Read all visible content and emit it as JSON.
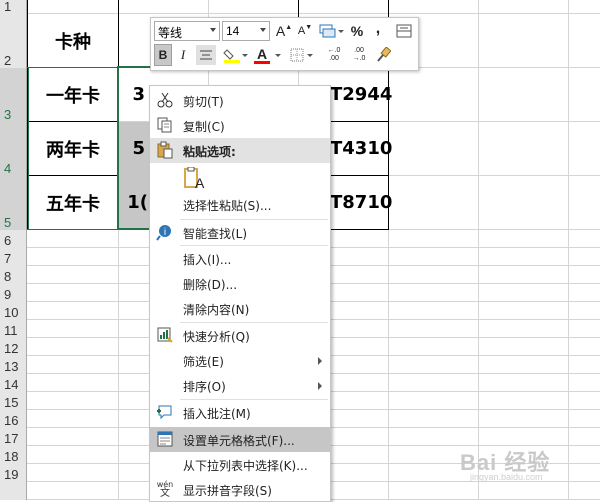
{
  "rows": [
    {
      "label": "1"
    },
    {
      "label": "2"
    },
    {
      "label": "3"
    },
    {
      "label": "4"
    },
    {
      "label": "5"
    },
    {
      "label": "6"
    },
    {
      "label": "7"
    },
    {
      "label": "8"
    },
    {
      "label": "9"
    },
    {
      "label": "10"
    },
    {
      "label": "11"
    },
    {
      "label": "12"
    },
    {
      "label": "13"
    },
    {
      "label": "14"
    },
    {
      "label": "15"
    },
    {
      "label": "16"
    },
    {
      "label": "17"
    },
    {
      "label": "18"
    },
    {
      "label": "19"
    }
  ],
  "cells": {
    "header": "卡种",
    "card_types": [
      "一年卡",
      "两年卡",
      "五年卡"
    ],
    "partial_b": [
      "3",
      "5",
      "1("
    ],
    "partial_d": [
      "T2944",
      "T4310",
      "T8710"
    ]
  },
  "mini_toolbar": {
    "font_name": "等线",
    "font_size": "14",
    "grow_font": "A",
    "shrink_font": "A",
    "percent": "%",
    "comma": ",",
    "bold": "B",
    "italic": "I",
    "font_color": "A",
    "inc_decimal": "←.0 .00",
    "dec_decimal": ".00 →.0",
    "colors": {
      "fill": "#ffff00",
      "font": "#ff0000"
    }
  },
  "context_menu": {
    "items": [
      {
        "label": "剪切(T)",
        "icon": "scissors-icon"
      },
      {
        "label": "复制(C)",
        "icon": "copy-icon"
      },
      {
        "label": "粘贴选项:",
        "icon": "clipboard-icon"
      },
      {
        "label": "选择性粘贴(S)...",
        "icon": ""
      },
      {
        "label": "智能查找(L)",
        "icon": "smart-lookup-icon"
      },
      {
        "label": "插入(I)...",
        "icon": ""
      },
      {
        "label": "删除(D)...",
        "icon": ""
      },
      {
        "label": "清除内容(N)",
        "icon": ""
      },
      {
        "label": "快速分析(Q)",
        "icon": "quick-analysis-icon"
      },
      {
        "label": "筛选(E)",
        "icon": ""
      },
      {
        "label": "排序(O)",
        "icon": ""
      },
      {
        "label": "插入批注(M)",
        "icon": "comment-icon"
      },
      {
        "label": "设置单元格格式(F)...",
        "icon": "format-cells-icon"
      },
      {
        "label": "从下拉列表中选择(K)...",
        "icon": ""
      },
      {
        "label": "显示拼音字段(S)",
        "icon": "phonetic-icon"
      }
    ],
    "paste_glyph": "A",
    "phonetic_top": "wén",
    "phonetic_bottom": "文"
  },
  "watermark": {
    "text": "Bai 经验",
    "sub": "jingyan.baidu.com"
  }
}
